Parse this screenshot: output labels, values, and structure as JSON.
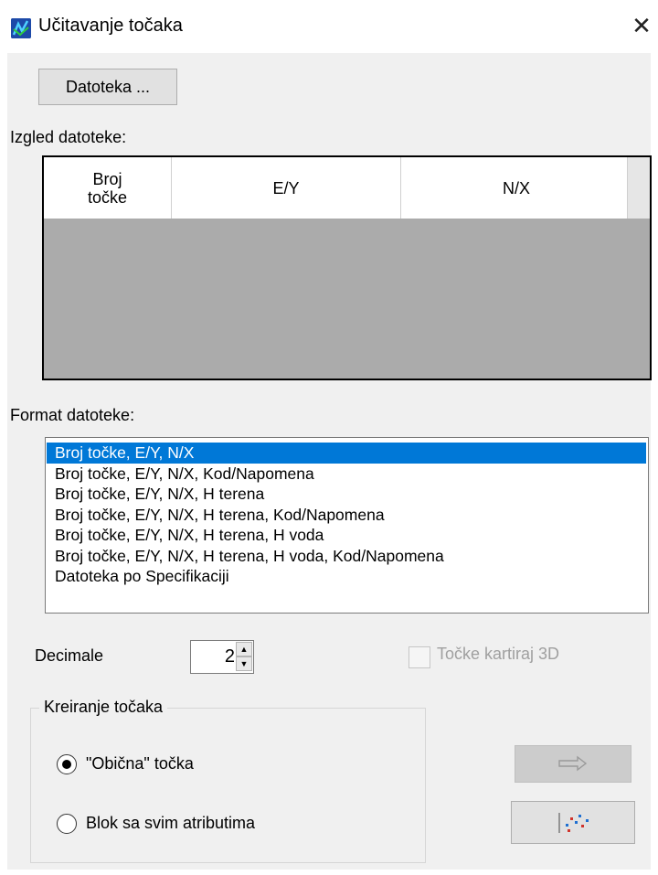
{
  "window": {
    "title": "Učitavanje točaka",
    "close_symbol": "✕",
    "icon": "app-icon"
  },
  "file_button": {
    "label": "Datoteka ..."
  },
  "preview": {
    "label": "Izgled datoteke:",
    "columns": [
      "Broj točke",
      "E/Y",
      "N/X"
    ]
  },
  "format": {
    "label": "Format datoteke:",
    "options": [
      "Broj točke, E/Y, N/X",
      "Broj točke, E/Y, N/X, Kod/Napomena",
      "Broj točke, E/Y, N/X, H terena",
      "Broj točke, E/Y, N/X, H terena, Kod/Napomena",
      "Broj točke, E/Y, N/X, H terena, H voda",
      "Broj točke, E/Y, N/X, H terena, H voda, Kod/Napomena",
      "Datoteka po Specifikaciji"
    ],
    "selected_index": 0
  },
  "decimals": {
    "label": "Decimale",
    "value": "2",
    "up_symbol": "▲",
    "down_symbol": "▼"
  },
  "map3d_checkbox": {
    "label": "Točke kartiraj 3D",
    "checked": false,
    "enabled": false
  },
  "creation_group": {
    "title": "Kreiranje točaka",
    "options": [
      "\"Obična\" točka",
      "Blok sa svim atributima"
    ],
    "selected_index": 0
  },
  "action_buttons": {
    "arrow": {
      "icon": "arrow-right-icon",
      "enabled": false
    },
    "scatter": {
      "icon": "point-scatter-icon",
      "enabled": true
    }
  },
  "colors": {
    "selection": "#0078d7",
    "dialog_bg": "#f0f0f0",
    "grid_bg": "#ababab"
  }
}
